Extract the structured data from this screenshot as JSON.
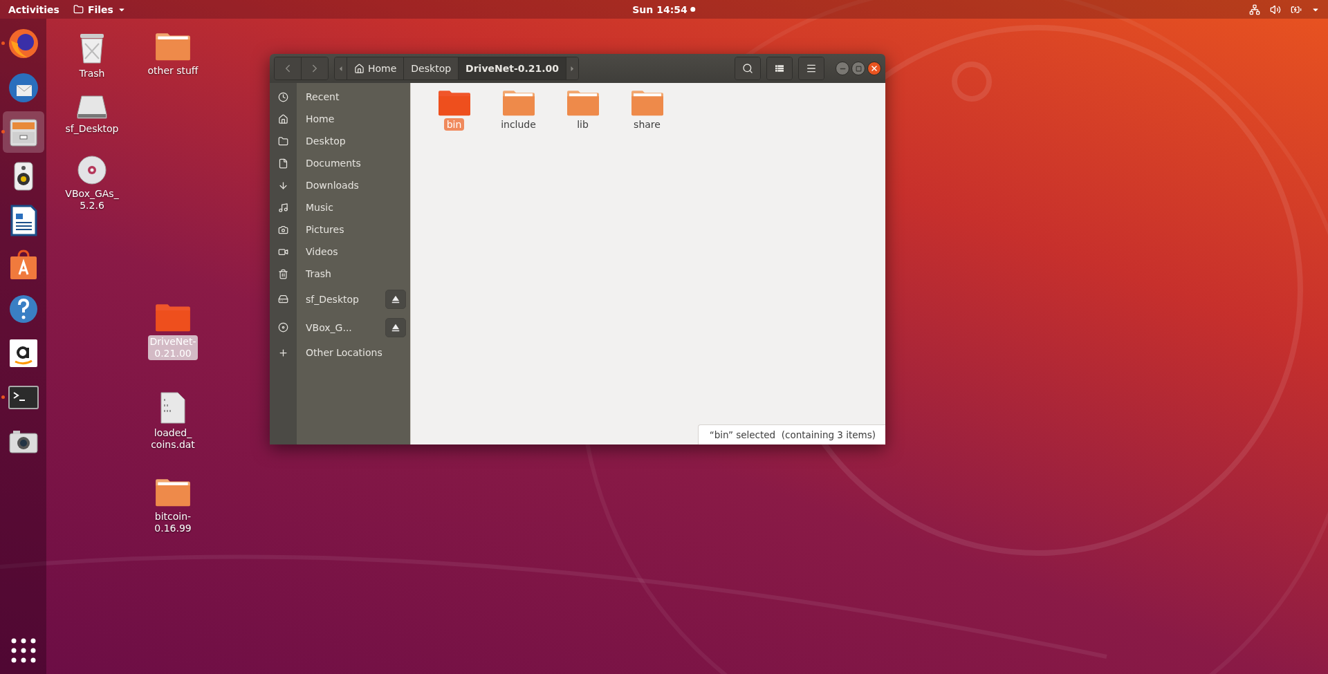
{
  "top_bar": {
    "activities": "Activities",
    "app_menu": {
      "label": "Files"
    },
    "clock": "Sun 14:54",
    "notification": true
  },
  "dock": {
    "items": [
      {
        "kind": "firefox",
        "running": true,
        "selected": false
      },
      {
        "kind": "mail",
        "running": false,
        "selected": false
      },
      {
        "kind": "files",
        "running": true,
        "selected": true
      },
      {
        "kind": "speaker",
        "running": false,
        "selected": false
      },
      {
        "kind": "writer",
        "running": false,
        "selected": false
      },
      {
        "kind": "store",
        "running": false,
        "selected": false
      },
      {
        "kind": "help",
        "running": false,
        "selected": false
      },
      {
        "kind": "amazon",
        "running": false,
        "selected": false
      },
      {
        "kind": "terminal",
        "running": true,
        "selected": false
      },
      {
        "kind": "camera",
        "running": false,
        "selected": false
      }
    ]
  },
  "desktop_icons": [
    {
      "label": "Trash",
      "kind": "trash",
      "selected": false
    },
    {
      "label": "other stuff",
      "kind": "folder",
      "selected": false
    },
    {
      "label": "sf_Desktop",
      "kind": "drive",
      "selected": false
    },
    {
      "label": "VBox_GAs_\n5.2.6",
      "kind": "disc",
      "selected": false
    },
    {
      "label": "DriveNet-\n0.21.00",
      "kind": "folder",
      "selected": true
    },
    {
      "label": "loaded_\ncoins.dat",
      "kind": "file",
      "selected": false
    },
    {
      "label": "bitcoin-\n0.16.99",
      "kind": "folder",
      "selected": false
    }
  ],
  "window": {
    "breadcrumbs": [
      {
        "label": "Home",
        "kind": "home",
        "selected": false
      },
      {
        "label": "Desktop",
        "kind": "folder",
        "selected": false
      },
      {
        "label": "DriveNet-0.21.00",
        "kind": "folder",
        "selected": true
      }
    ],
    "sidebar": {
      "items": [
        {
          "label": "Recent",
          "kind": "recent",
          "eject": false
        },
        {
          "label": "Home",
          "kind": "home",
          "eject": false
        },
        {
          "label": "Desktop",
          "kind": "desktop",
          "eject": false
        },
        {
          "label": "Documents",
          "kind": "documents",
          "eject": false
        },
        {
          "label": "Downloads",
          "kind": "downloads",
          "eject": false
        },
        {
          "label": "Music",
          "kind": "music",
          "eject": false
        },
        {
          "label": "Pictures",
          "kind": "pictures",
          "eject": false
        },
        {
          "label": "Videos",
          "kind": "videos",
          "eject": false
        },
        {
          "label": "Trash",
          "kind": "trash",
          "eject": false
        },
        {
          "label": "sf_Desktop",
          "kind": "drive",
          "eject": true
        },
        {
          "label": "VBox_G...",
          "kind": "disc",
          "eject": true
        },
        {
          "label": "Other Locations",
          "kind": "other",
          "eject": false
        }
      ]
    },
    "files": [
      {
        "label": "bin",
        "selected": true
      },
      {
        "label": "include",
        "selected": false
      },
      {
        "label": "lib",
        "selected": false
      },
      {
        "label": "share",
        "selected": false
      }
    ],
    "status": "“bin” selected  (containing 3 items)"
  }
}
